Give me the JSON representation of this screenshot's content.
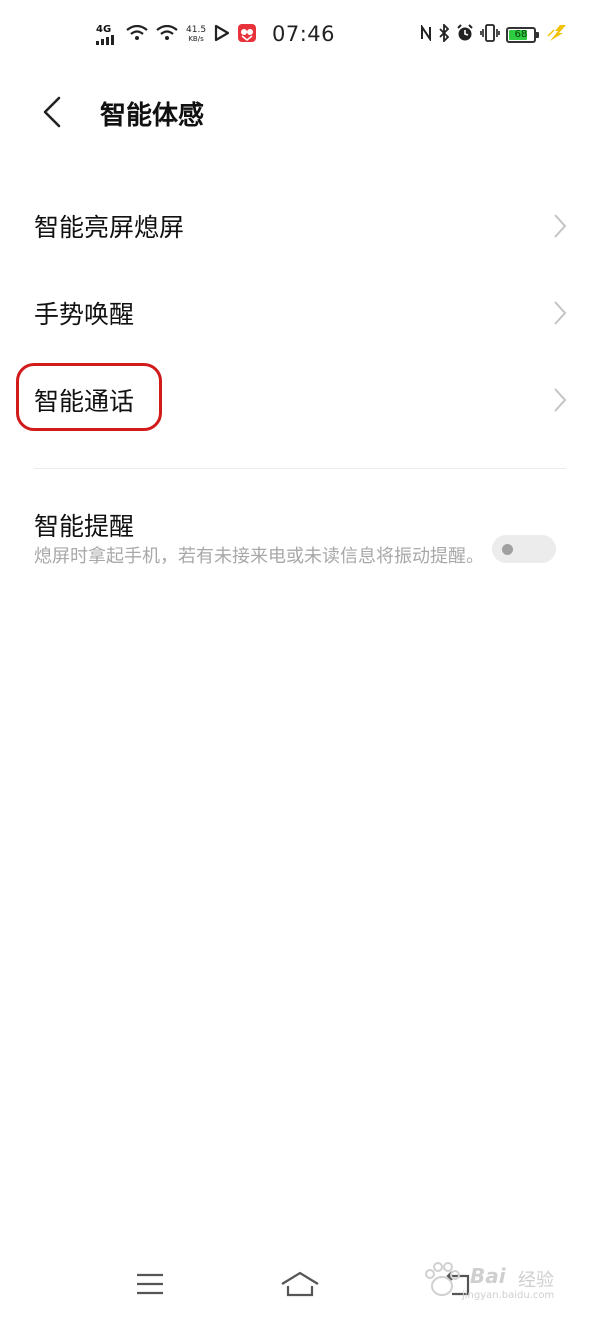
{
  "status_bar": {
    "network": "4G",
    "speed_value": "41.5",
    "speed_unit": "KB/s",
    "time": "07:46",
    "battery": "68",
    "colors": {
      "battery_fill": "#2ecc40",
      "charging": "#f2c200",
      "app_icon": "#e8323c"
    }
  },
  "header": {
    "title": "智能体感",
    "back_icon": "back-arrow-icon"
  },
  "menu": [
    {
      "label": "智能亮屏熄屏"
    },
    {
      "label": "手势唤醒"
    },
    {
      "label": "智能通话"
    }
  ],
  "smart_reminder": {
    "title": "智能提醒",
    "description": "熄屏时拿起手机，若有未接来电或未读信息将振动提醒。",
    "enabled": false
  },
  "navbar": {
    "items": [
      "menu-icon",
      "home-icon",
      "back-icon"
    ]
  },
  "watermark": {
    "brand": "Bai",
    "cn": "经验",
    "url": "jingyan.baidu.com"
  },
  "highlight_color": "#d11a1a"
}
